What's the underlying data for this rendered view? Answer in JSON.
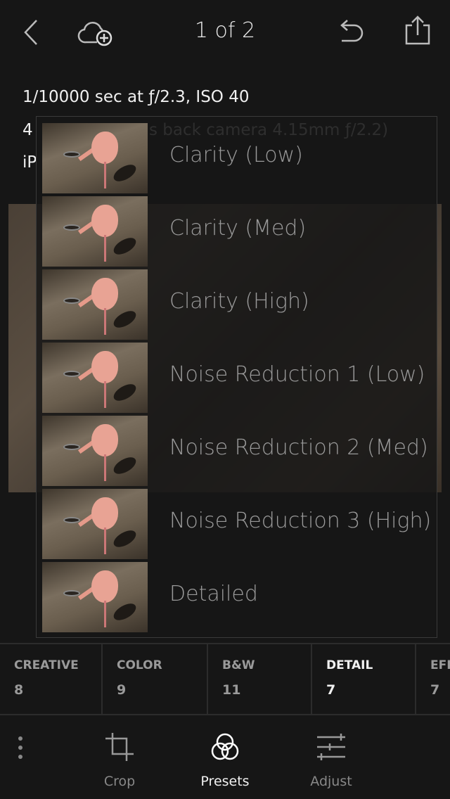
{
  "header": {
    "title": "1 of 2",
    "back_icon": "chevron-left-icon",
    "cloud_icon": "cloud-add-icon",
    "undo_icon": "undo-icon",
    "share_icon": "share-icon"
  },
  "metadata": {
    "line1": "1/10000 sec at ƒ/2.3, ISO 40",
    "line2_prefix": "4",
    "line2_visible": "s back camera 4.15mm ƒ/2.2)",
    "line3_prefix": "iP"
  },
  "presets": [
    {
      "label": "Clarity (Low)"
    },
    {
      "label": "Clarity (Med)"
    },
    {
      "label": "Clarity (High)"
    },
    {
      "label": "Noise Reduction 1 (Low)"
    },
    {
      "label": "Noise Reduction 2 (Med)"
    },
    {
      "label": "Noise Reduction 3 (High)"
    },
    {
      "label": "Detailed"
    }
  ],
  "categories": [
    {
      "name": "CREATIVE",
      "count": "8"
    },
    {
      "name": "COLOR",
      "count": "9"
    },
    {
      "name": "B&W",
      "count": "11"
    },
    {
      "name": "DETAIL",
      "count": "7",
      "active": true
    },
    {
      "name": "EFF",
      "count": "7"
    }
  ],
  "toolbar": {
    "more_icon": "more-vertical-icon",
    "tools": [
      {
        "label": "Crop",
        "icon": "crop-icon"
      },
      {
        "label": "Presets",
        "icon": "presets-icon",
        "active": true
      },
      {
        "label": "Adjust",
        "icon": "sliders-icon"
      }
    ]
  }
}
